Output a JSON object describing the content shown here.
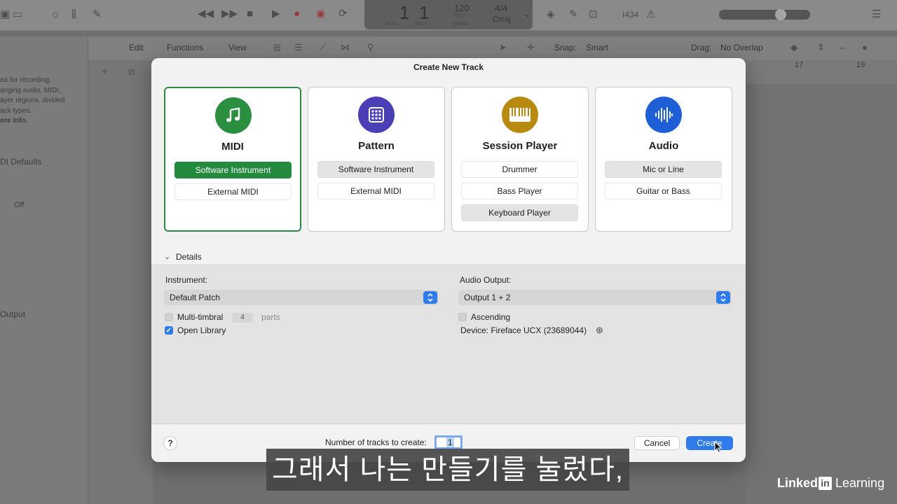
{
  "background": {
    "lcd": {
      "bar": "1",
      "beat": "1",
      "bar_caption": "BAR",
      "beat_caption": "BEAT",
      "tempo": "120",
      "tempo_mode": "KEEP",
      "tempo_caption": "TEMPO",
      "time_signature": "4/4",
      "key": "Cmaj"
    },
    "io_label": "Ι434",
    "toolbar2": {
      "edit": "Edit",
      "functions": "Functions",
      "view": "View",
      "snap_label": "Snap:",
      "snap_value": "Smart",
      "drag_label": "Drag:",
      "drag_value": "No Overlap"
    },
    "ruler": {
      "mark1": "17",
      "mark2": "19"
    },
    "left_panel": {
      "help_lines": [
        "ea for recording,",
        "anging audio, MIDI,",
        "ayer regions, divided",
        "ack types."
      ],
      "more_info": "ore info.",
      "midi_defaults": "DI Defaults",
      "off_value": "Off",
      "output": "Output"
    }
  },
  "dialog": {
    "title": "Create New Track",
    "cards": [
      {
        "name": "MIDI",
        "icon": "music-note-icon",
        "color": "#2a8f3f",
        "selected": true,
        "options": [
          "Software Instrument",
          "External MIDI"
        ]
      },
      {
        "name": "Pattern",
        "icon": "grid-pattern-icon",
        "color": "#4a3fb5",
        "selected": false,
        "options": [
          "Software Instrument",
          "External MIDI"
        ]
      },
      {
        "name": "Session Player",
        "icon": "piano-keys-icon",
        "color": "#b88a10",
        "selected": false,
        "options": [
          "Drummer",
          "Bass Player",
          "Keyboard Player"
        ]
      },
      {
        "name": "Audio",
        "icon": "waveform-icon",
        "color": "#1f5fd6",
        "selected": false,
        "options": [
          "Mic or Line",
          "Guitar or Bass"
        ]
      }
    ],
    "details": {
      "toggle_label": "Details",
      "instrument_label": "Instrument:",
      "instrument_value": "Default Patch",
      "multitimbral_label": "Multi-timbral",
      "multitimbral_parts": "4",
      "parts_label": "parts",
      "open_library_label": "Open Library",
      "audio_output_label": "Audio Output:",
      "audio_output_value": "Output 1 + 2",
      "ascending_label": "Ascending",
      "device_label": "Device: Fireface UCX (23689044)"
    },
    "footer": {
      "help": "?",
      "tracks_label": "Number of tracks to create:",
      "tracks_value": "1",
      "cancel": "Cancel",
      "create": "Create"
    }
  },
  "subtitle": "그래서 나는 만들기를 눌렀다,",
  "watermark": {
    "linked": "Linked",
    "in": "in",
    "learning": " Learning"
  }
}
